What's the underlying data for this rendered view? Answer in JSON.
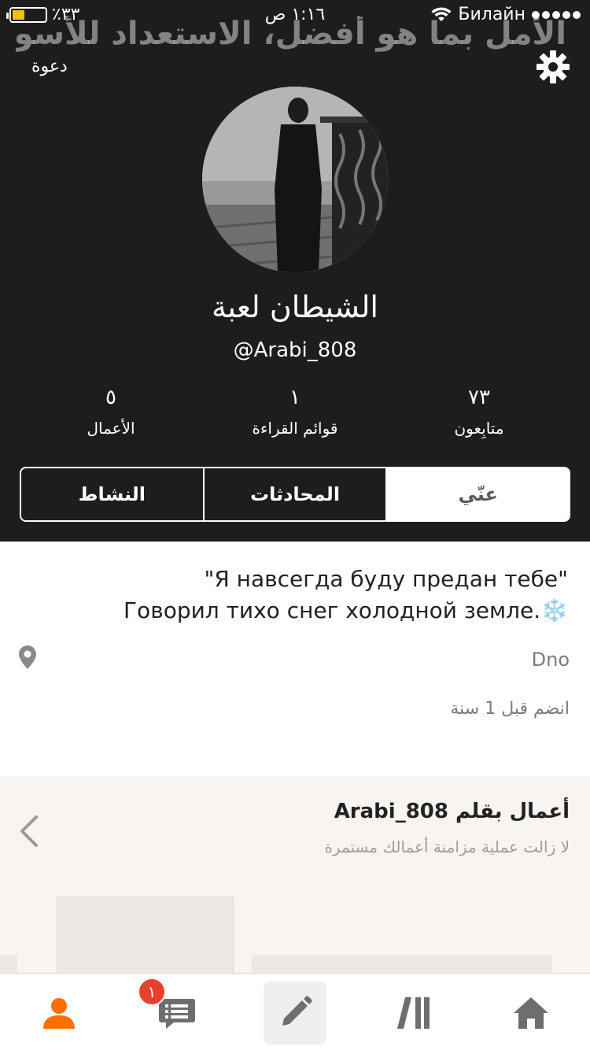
{
  "status_bar": {
    "battery_text": "٪٣٣",
    "time": "١:١٦ ص",
    "carrier": "Билайн"
  },
  "header": {
    "banner_text": "الأمل بما هو أفضل، الاستعداد للأسوأ",
    "invite_label": "دعوة",
    "display_name": "الشيطان لعبة",
    "username": "@Arabi_808"
  },
  "stats": {
    "works": {
      "value": "٥",
      "label": "الأعمال"
    },
    "reading_lists": {
      "value": "١",
      "label": "قوائم القراءة"
    },
    "followers": {
      "value": "٧٣",
      "label": "متابِعون"
    }
  },
  "tabs": [
    {
      "label": "النشاط",
      "active": false
    },
    {
      "label": "المحادثات",
      "active": false
    },
    {
      "label": "عنّي",
      "active": true
    }
  ],
  "about": {
    "bio_line1": "\"Я навсегда буду предан тебе\"",
    "bio_line2": "Говорил тихо снег холодной земле.❄️",
    "location": "Dno",
    "joined": "انضم قبل 1 سنة"
  },
  "works_section": {
    "title": "أعمال بقلم Arabi_808",
    "subtitle": "لا زالت عملية مزامنة أعمالك مستمرة"
  },
  "bottom_nav": {
    "messages_badge": "١",
    "accent_color": "#ff6f00",
    "icon_color": "#6e6e6e"
  }
}
